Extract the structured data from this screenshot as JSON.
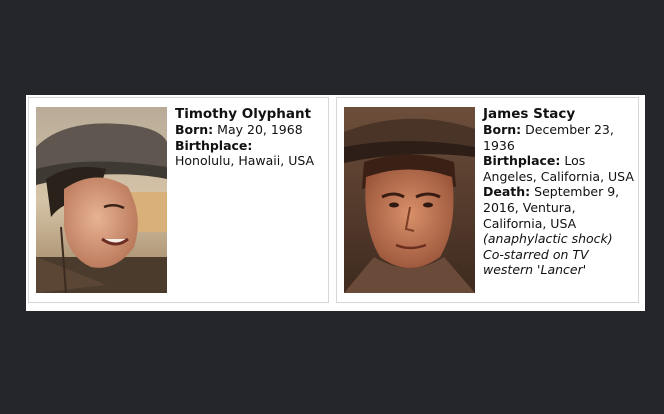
{
  "cards": [
    {
      "name": "Timothy Olyphant",
      "born_label": "Born:",
      "born_value": "May 20, 1968",
      "birthplace_label": "Birthplace:",
      "birthplace_value": "Honolulu, Hawaii, USA"
    },
    {
      "name": "James Stacy",
      "born_label": "Born:",
      "born_value": "December 23, 1936",
      "birthplace_label": "Birthplace:",
      "birthplace_value": "Los Angeles, California, USA",
      "death_label": "Death:",
      "death_value": "September 9, 2016, Ventura, California, USA",
      "death_cause": "(anaphylactic shock)",
      "note": "Co-starred on TV western 'Lancer'"
    }
  ]
}
